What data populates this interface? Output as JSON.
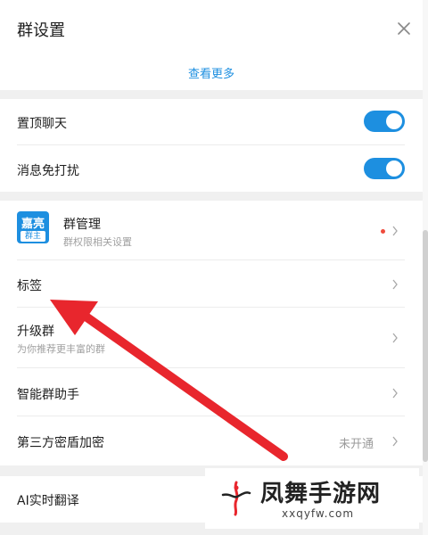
{
  "header": {
    "title": "群设置"
  },
  "see_more": "查看更多",
  "toggles": [
    {
      "label": "置顶聊天",
      "on": true
    },
    {
      "label": "消息免打扰",
      "on": true
    }
  ],
  "group_admin": {
    "avatar_line1": "嘉亮",
    "avatar_line2": "群主",
    "title": "群管理",
    "subtitle": "群权限相关设置",
    "has_red_dot": true
  },
  "items": {
    "tags": "标签",
    "upgrade": "升级群",
    "upgrade_sub": "为你推荐更丰富的群",
    "assistant": "智能群助手",
    "encryption": "第三方密盾加密",
    "encryption_status": "未开通",
    "ai_translate": "AI实时翻译"
  },
  "watermark": {
    "name": "凤舞手游网",
    "url": "xxqyfw.com"
  },
  "colors": {
    "accent": "#1d8fe0",
    "annotation_arrow": "#e8262d",
    "badge_dot": "#ef4b3c"
  },
  "icons": {
    "close": "close-icon",
    "chevron": "chevron-right-icon"
  }
}
